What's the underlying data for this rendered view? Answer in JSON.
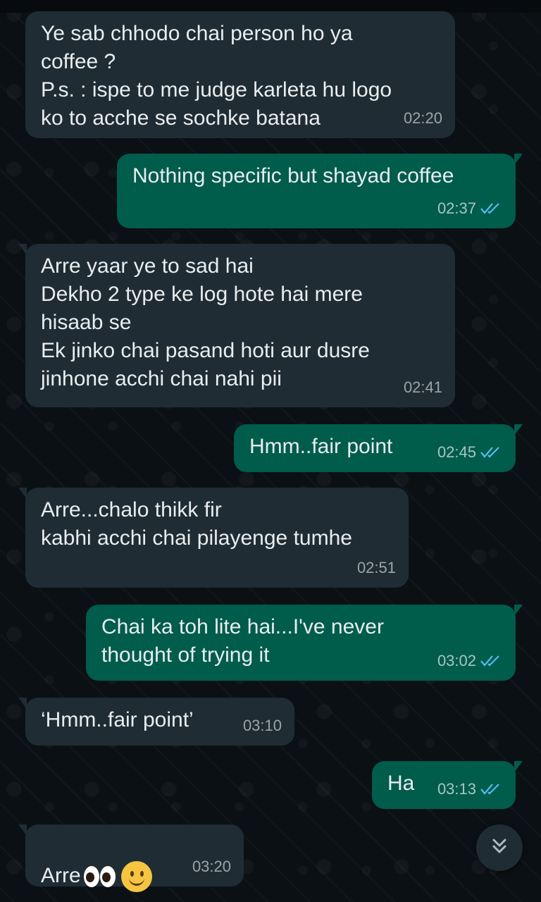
{
  "messages": [
    {
      "direction": "in",
      "text": "Ye sab chhodo chai person ho ya\ncoffee ?\nP.s. : ispe to me judge karleta hu logo\nko to acche se sochke batana",
      "time": "02:20"
    },
    {
      "direction": "out",
      "text": "Nothing specific but shayad coffee",
      "time": "02:37",
      "status": "read"
    },
    {
      "direction": "in",
      "text": "Arre yaar ye to sad hai\nDekho 2 type ke log hote hai mere\nhisaab se\nEk jinko chai pasand hoti aur dusre\njinhone acchi chai nahi pii",
      "time": "02:41"
    },
    {
      "direction": "out",
      "text": "Hmm..fair point",
      "time": "02:45",
      "status": "read"
    },
    {
      "direction": "in",
      "text": "Arre...chalo thikk fir\nkabhi acchi chai pilayenge tumhe",
      "time": "02:51"
    },
    {
      "direction": "out",
      "text": "Chai ka toh lite hai...I've never\nthought of trying it",
      "time": "03:02",
      "status": "read"
    },
    {
      "direction": "in",
      "text": "‘Hmm..fair point’",
      "time": "03:10"
    },
    {
      "direction": "out",
      "text": "Ha",
      "time": "03:13",
      "status": "read"
    },
    {
      "direction": "in",
      "text": "Arre",
      "emoji": [
        "eyes",
        "slightly-smiling-face"
      ],
      "time": "03:20"
    }
  ],
  "icons": {
    "read_receipt": "double-check-icon",
    "scroll_button": "double-chevron-down-icon"
  },
  "colors": {
    "incoming_bubble": "#1f2c33",
    "outgoing_bubble": "#005c4b",
    "read_tick": "#53bdeb",
    "background": "#0b1014"
  }
}
